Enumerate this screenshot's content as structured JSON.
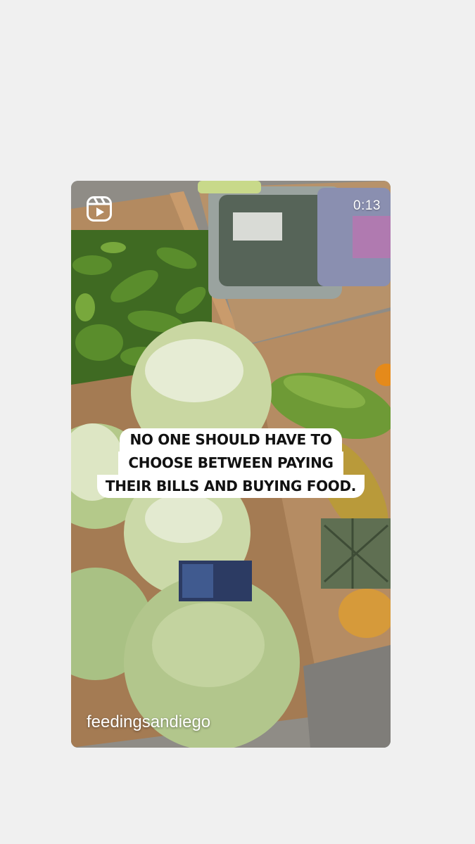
{
  "post": {
    "duration": "0:13",
    "caption_lines": [
      "NO ONE SHOULD HAVE TO",
      "CHOOSE BETWEEN PAYING",
      "THEIR BILLS AND BUYING FOOD."
    ],
    "username": "feedingsandiego",
    "icon": "reels-icon"
  },
  "colors": {
    "page_background": "#f0f0f0",
    "caption_background": "#ffffff",
    "caption_text": "#111111",
    "overlay_text": "#ffffff"
  }
}
